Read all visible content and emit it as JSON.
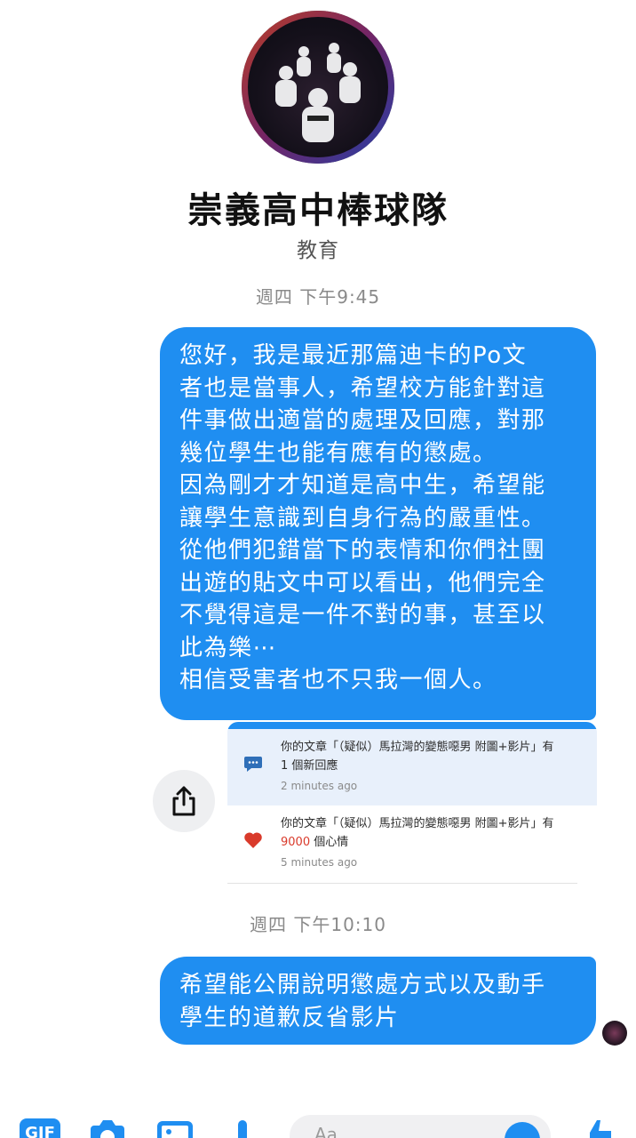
{
  "header": {
    "page_title": "崇義高中棒球隊",
    "page_category": "教育",
    "avatar_icon": "team-photo-avatar"
  },
  "conversation": {
    "timestamp_1": "週四 下午9:45",
    "message_1": "您好，我是最近那篇迪卡的Po文\n者也是當事人，希望校方能針對這\n件事做出適當的處理及回應，對那\n幾位學生也能有應有的懲處。\n因為剛才才知道是高中生，希望能\n讓學生意識到自身行為的嚴重性。\n從他們犯錯當下的表情和你們社團\n出遊的貼文中可以看出，他們完全\n不覺得這是一件不對的事，甚至以\n此為樂⋯\n相信受害者也不只我一個人。",
    "attachment": {
      "notif_1_line_1": "你的文章「（疑似）馬拉灣的變態噁男 附圖+影片」有",
      "notif_1_line_2": "1 個新回應",
      "notif_1_time": "2 minutes ago",
      "notif_2_line_1": "你的文章「（疑似）馬拉灣的變態噁男 附圖+影片」有",
      "notif_2_count": "9000",
      "notif_2_suffix": " 個心情",
      "notif_2_time": "5 minutes ago"
    },
    "timestamp_2": "週四 下午10:10",
    "message_2": "希望能公開說明懲處方式以及動手\n學生的道歉反省影片"
  },
  "composer": {
    "gif_label": "GIF",
    "input_placeholder": "Aa"
  },
  "colors": {
    "accent": "#1f8ef1",
    "heart": "#d93a2b",
    "notif_bg": "#e8f0fb"
  }
}
